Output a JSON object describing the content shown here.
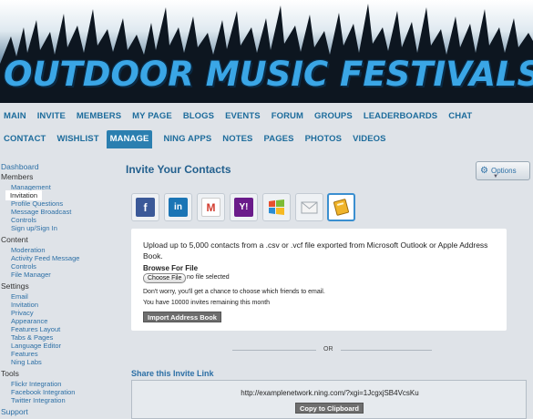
{
  "banner": {
    "title": "OUTDOOR MUSIC FESTIVALS"
  },
  "nav": {
    "row1": [
      "MAIN",
      "INVITE",
      "MEMBERS",
      "MY PAGE",
      "BLOGS",
      "EVENTS",
      "FORUM",
      "GROUPS",
      "LEADERBOARDS",
      "CHAT"
    ],
    "row2": [
      "CONTACT",
      "WISHLIST",
      "MANAGE",
      "NING APPS",
      "NOTES",
      "PAGES",
      "PHOTOS",
      "VIDEOS"
    ],
    "active": "MANAGE"
  },
  "sidebar": {
    "dashboard": "Dashboard",
    "members_head": "Members",
    "management": "Management",
    "invitation": "Invitation",
    "profile_questions": "Profile Questions",
    "message_broadcast": "Message Broadcast",
    "controls1": "Controls",
    "signup": "Sign up/Sign In",
    "content_head": "Content",
    "moderation": "Moderation",
    "activity_feed": "Activity Feed Message",
    "controls2": "Controls",
    "file_manager": "File Manager",
    "settings_head": "Settings",
    "email": "Email",
    "invitation2": "Invitation",
    "privacy": "Privacy",
    "appearance": "Appearance",
    "features_layout": "Features Layout",
    "tabs_pages": "Tabs & Pages",
    "language_editor": "Language Editor",
    "features": "Features",
    "ning_labs": "Ning Labs",
    "tools_head": "Tools",
    "flickr": "Flickr Integration",
    "facebook": "Facebook Integration",
    "twitter": "Twitter Integration",
    "support": "Support"
  },
  "main": {
    "title": "Invite Your Contacts",
    "options_label": "Options",
    "providers": [
      "facebook",
      "linkedin",
      "gmail",
      "yahoo",
      "windows-live",
      "email",
      "address-book"
    ],
    "provider_glyphs": [
      "f",
      "in",
      "M",
      "Y!",
      "",
      "",
      ""
    ],
    "selected_provider": "address-book",
    "card": {
      "description": "Upload up to 5,000 contacts from a .csv or .vcf file exported from Microsoft Outlook or Apple Address Book.",
      "browse_label": "Browse For File",
      "choose_file": "Choose File",
      "no_file": "no file selected",
      "note": "Don't worry, you'll get a chance to choose which friends to email.",
      "remaining": "You have 10000 invites remaining this month",
      "import_button": "Import Address Book"
    },
    "or_text": "OR",
    "share": {
      "title": "Share this Invite Link",
      "url": "http://examplenetwork.ning.com/?xgi=1JcgxjSB4VcsKu",
      "copy_button": "Copy to Clipboard"
    }
  },
  "colors": {
    "accent": "#2b7fb0",
    "link": "#2c6fa5",
    "background": "#dfe3e8"
  }
}
